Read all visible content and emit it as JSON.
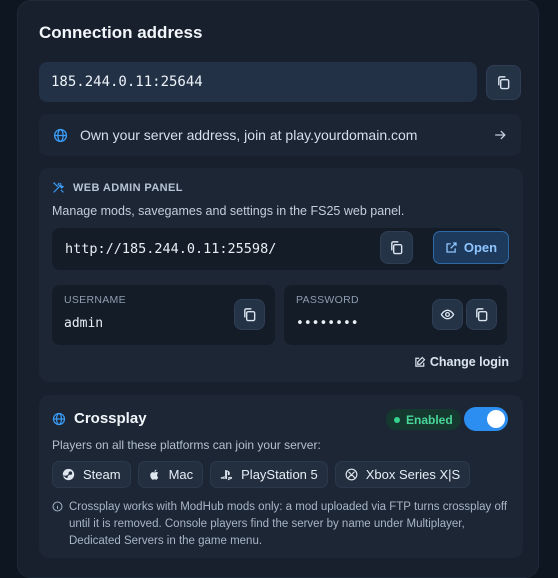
{
  "connection": {
    "title": "Connection address",
    "address": "185.244.0.11:25644",
    "own_address_text": "Own your server address, join at play.yourdomain.com"
  },
  "web_admin": {
    "heading": "WEB ADMIN PANEL",
    "description": "Manage mods, savegames and settings in the FS25 web panel.",
    "url": "http://185.244.0.11:25598/",
    "open_label": "Open",
    "username_label": "USERNAME",
    "username_value": "admin",
    "password_label": "PASSWORD",
    "password_value": "••••••••",
    "change_login_label": "Change login"
  },
  "crossplay": {
    "title": "Crossplay",
    "status": "Enabled",
    "enabled": true,
    "description": "Players on all these platforms can join your server:",
    "platforms": [
      {
        "label": "Steam",
        "icon": "steam-icon"
      },
      {
        "label": "Mac",
        "icon": "apple-icon"
      },
      {
        "label": "PlayStation 5",
        "icon": "playstation-icon"
      },
      {
        "label": "Xbox Series X|S",
        "icon": "xbox-icon"
      }
    ],
    "note": "Crossplay works with ModHub mods only: a mod uploaded via FTP turns crossplay off until it is removed. Console players find the server by name under Multiplayer, Dedicated Servers in the game menu."
  },
  "colors": {
    "background": "#0e1621",
    "card": "#17202c",
    "accent": "#2b8ef0",
    "enabled_green": "#35d38d"
  }
}
